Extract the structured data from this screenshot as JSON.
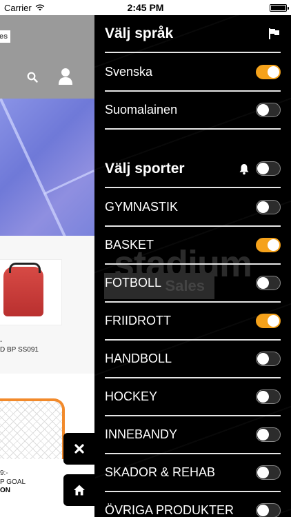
{
  "status_bar": {
    "carrier": "Carrier",
    "time": "2:45 PM"
  },
  "background_app": {
    "logo_text": "les",
    "product1": {
      "price": "-",
      "name": "D BP SS091"
    },
    "product2": {
      "price": "9:-",
      "name": "P GOAL",
      "tag": "ON"
    }
  },
  "drawer": {
    "language_section": {
      "title": "Välj språk",
      "items": [
        {
          "label": "Svenska",
          "on": true
        },
        {
          "label": "Suomalainen",
          "on": false
        }
      ]
    },
    "sports_section": {
      "title": "Välj sporter",
      "notifications_on": false,
      "items": [
        {
          "label": "GYMNASTIK",
          "on": false
        },
        {
          "label": "BASKET",
          "on": true
        },
        {
          "label": "FOTBOLL",
          "on": false
        },
        {
          "label": "FRIIDROTT",
          "on": true
        },
        {
          "label": "HANDBOLL",
          "on": false
        },
        {
          "label": "HOCKEY",
          "on": false
        },
        {
          "label": "INNEBANDY",
          "on": false
        },
        {
          "label": "SKADOR & REHAB",
          "on": false
        },
        {
          "label": "ÖVRIGA PRODUKTER",
          "on": false
        }
      ]
    },
    "watermark": {
      "brand": "stadium",
      "sub": "Sales"
    }
  },
  "colors": {
    "accent": "#f5a21b",
    "drawer_bg": "#000000",
    "divider": "#e6e6e6"
  }
}
